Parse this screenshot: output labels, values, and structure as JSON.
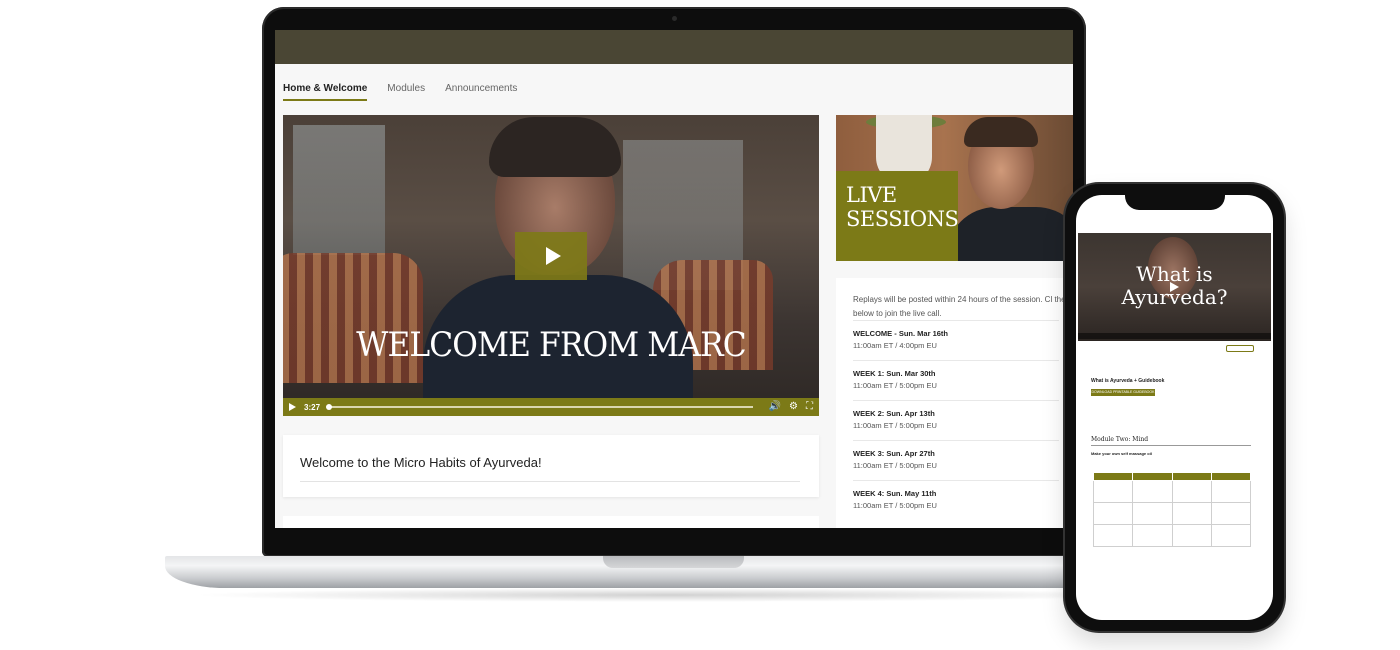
{
  "tabs": [
    {
      "label": "Home & Welcome",
      "active": true
    },
    {
      "label": "Modules",
      "active": false
    },
    {
      "label": "Announcements",
      "active": false
    }
  ],
  "video": {
    "title": "WELCOME FROM MARC",
    "duration": "3:27",
    "play_icon": "play-icon",
    "volume_icon": "volume-icon",
    "settings_icon": "gear-icon",
    "fullscreen_icon": "fullscreen-icon"
  },
  "welcome": {
    "heading": "Welcome to the Micro Habits of Ayurveda!"
  },
  "live": {
    "line1": "LIVE",
    "line2": "SESSIONS",
    "note": "Replays will be posted within 24 hours of the session. Cl the button below to join the live call.",
    "sessions": [
      {
        "title": "WELCOME - Sun. Mar 16th",
        "time": "11:00am ET / 4:00pm EU"
      },
      {
        "title": "WEEK 1: Sun. Mar 30th",
        "time": "11:00am ET / 5:00pm EU"
      },
      {
        "title": "WEEK 2: Sun. Apr 13th",
        "time": "11:00am ET / 5:00pm EU"
      },
      {
        "title": "WEEK 3: Sun. Apr 27th",
        "time": "11:00am ET / 5:00pm EU"
      },
      {
        "title": "WEEK 4: Sun. May 11th",
        "time": "11:00am ET / 5:00pm EU"
      }
    ]
  },
  "phone": {
    "video_line1": "What is",
    "video_line2": "Ayurveda?",
    "lesson_title": "What is Ayurveda + Guidebook",
    "download_label": "DOWNLOAD PRINTABLE GUIDEBOOK",
    "module_title": "Module Two: Mind",
    "module_sub": "Make your own self massage oil"
  },
  "colors": {
    "accent": "#7c7a17",
    "top_bar": "#4a4634"
  }
}
